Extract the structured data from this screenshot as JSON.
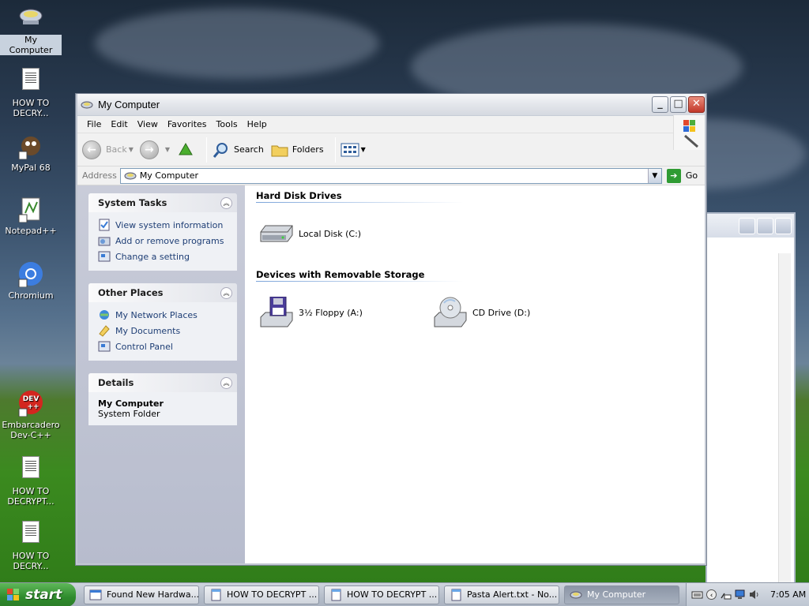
{
  "desktop": {
    "icons": [
      {
        "label": "My Computer"
      },
      {
        "label": "HOW TO DECRY..."
      },
      {
        "label": "MyPal 68"
      },
      {
        "label": "Notepad++"
      },
      {
        "label": "Chromium"
      },
      {
        "label": "Embarcadero Dev-C++"
      },
      {
        "label": "HOW TO DECRYPT..."
      },
      {
        "label": "HOW TO DECRY..."
      }
    ]
  },
  "window": {
    "title": "My Computer",
    "menu": [
      "File",
      "Edit",
      "View",
      "Favorites",
      "Tools",
      "Help"
    ],
    "toolbar": {
      "back": "Back",
      "search": "Search",
      "folders": "Folders"
    },
    "address": {
      "label": "Address",
      "value": "My Computer",
      "go": "Go"
    },
    "sidebar": {
      "system_tasks": {
        "title": "System Tasks",
        "items": [
          "View system information",
          "Add or remove programs",
          "Change a setting"
        ]
      },
      "other_places": {
        "title": "Other Places",
        "items": [
          "My Network Places",
          "My Documents",
          "Control Panel"
        ]
      },
      "details": {
        "title": "Details",
        "name": "My Computer",
        "sub": "System Folder"
      }
    },
    "content": {
      "groups": [
        {
          "title": "Hard Disk Drives",
          "items": [
            "Local Disk (C:)"
          ]
        },
        {
          "title": "Devices with Removable Storage",
          "items": [
            "3½ Floppy (A:)",
            "CD Drive (D:)"
          ]
        }
      ]
    }
  },
  "taskbar": {
    "start": "start",
    "buttons": [
      {
        "label": "Found New Hardwa..."
      },
      {
        "label": "HOW TO DECRYPT ..."
      },
      {
        "label": "HOW TO DECRYPT ..."
      },
      {
        "label": "Pasta Alert.txt - No..."
      },
      {
        "label": "My Computer"
      }
    ],
    "clock": "7:05 AM"
  }
}
